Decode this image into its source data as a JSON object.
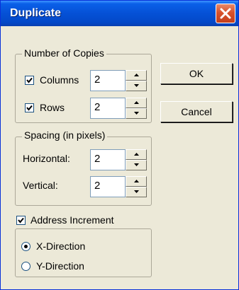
{
  "window": {
    "title": "Duplicate"
  },
  "copies_group": {
    "legend": "Number of Copies",
    "columns": {
      "label": "Columns",
      "checked": true,
      "value": "2"
    },
    "rows": {
      "label": "Rows",
      "checked": true,
      "value": "2"
    }
  },
  "spacing_group": {
    "legend": "Spacing (in pixels)",
    "horizontal": {
      "label": "Horizontal:",
      "value": "2"
    },
    "vertical": {
      "label": "Vertical:",
      "value": "2"
    }
  },
  "address": {
    "label": "Address Increment",
    "checked": true,
    "options": [
      {
        "label": "X-Direction",
        "selected": true
      },
      {
        "label": "Y-Direction",
        "selected": false
      }
    ]
  },
  "buttons": {
    "ok": "OK",
    "cancel": "Cancel"
  },
  "colors": {
    "titlebar": "#0551d6",
    "close": "#d8522c",
    "face": "#ece9d8"
  }
}
